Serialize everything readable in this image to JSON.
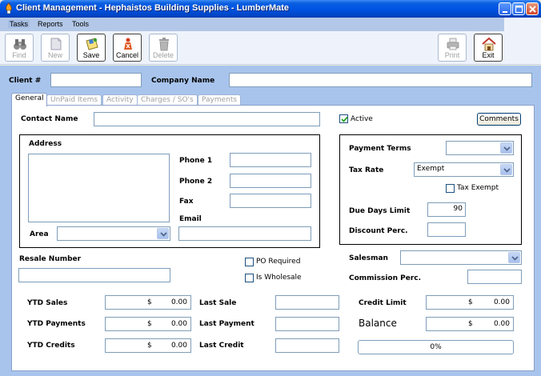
{
  "window": {
    "title": "Client Management - Hephaistos Building Supplies - LumberMate"
  },
  "menu": {
    "items": [
      "Tasks",
      "Reports",
      "Tools"
    ]
  },
  "toolbar": {
    "find": "Find",
    "new": "New",
    "save": "Save",
    "cancel": "Cancel",
    "delete": "Delete",
    "print": "Print",
    "exit": "Exit"
  },
  "header": {
    "client_label": "Client #",
    "company_label": "Company Name",
    "client_value": "",
    "company_value": ""
  },
  "tabs": [
    "General",
    "UnPaid Items",
    "Activity",
    "Charges / SO's",
    "Payments"
  ],
  "general": {
    "contact_label": "Contact Name",
    "contact_value": "",
    "active_label": "Active",
    "active_checked": true,
    "comments_button": "Comments",
    "address_label": "Address",
    "phone1_label": "Phone 1",
    "phone2_label": "Phone 2",
    "fax_label": "Fax",
    "email_label": "Email",
    "area_label": "Area",
    "payment_terms_label": "Payment Terms",
    "tax_rate_label": "Tax Rate",
    "tax_rate_value": "Exempt",
    "tax_exempt_label": "Tax Exempt",
    "due_days_label": "Due Days Limit",
    "due_days_value": "90",
    "discount_label": "Discount Perc.",
    "resale_label": "Resale Number",
    "po_required_label": "PO Required",
    "wholesale_label": "Is Wholesale",
    "salesman_label": "Salesman",
    "commission_label": "Commission Perc."
  },
  "summary": {
    "ytd_sales_label": "YTD Sales",
    "ytd_payments_label": "YTD Payments",
    "ytd_credits_label": "YTD Credits",
    "last_sale_label": "Last Sale",
    "last_payment_label": "Last Payment",
    "last_credit_label": "Last Credit",
    "credit_limit_label": "Credit Limit",
    "balance_label": "Balance",
    "currency": "$",
    "ytd_sales": "0.00",
    "ytd_payments": "0.00",
    "ytd_credits": "0.00",
    "credit_limit": "0.00",
    "balance": "0.00",
    "progress_text": "0%",
    "progress_fraction": 0
  }
}
